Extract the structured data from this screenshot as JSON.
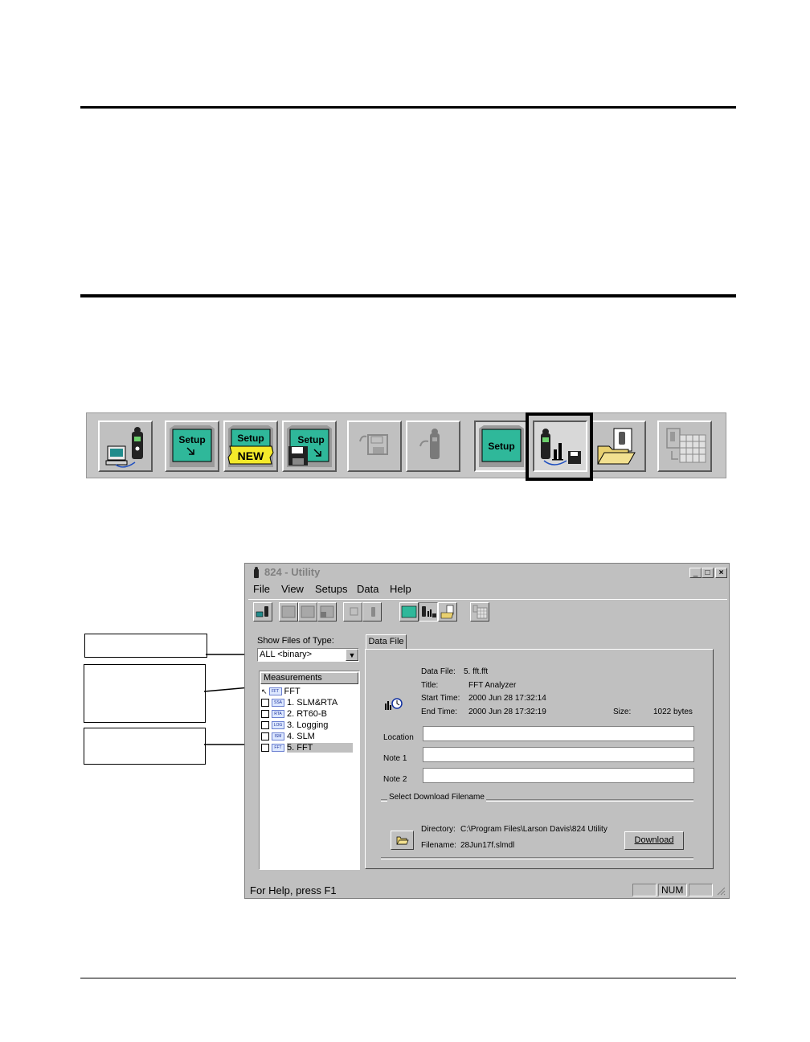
{
  "window": {
    "title": "824 - Utility",
    "controls": [
      "_",
      "□",
      "×"
    ]
  },
  "menu": [
    "File",
    "View",
    "Setups",
    "Data",
    "Help"
  ],
  "big_toolbar": {
    "highlighted_index": 7,
    "buttons": [
      {
        "icon": "computer-meter-icon"
      },
      {
        "icon": "setup-arrow-icon",
        "text": "Setup"
      },
      {
        "icon": "setup-new-icon",
        "text": "Setup",
        "badge": "NEW"
      },
      {
        "icon": "setup-save-icon",
        "text": "Setup"
      },
      {
        "icon": "save-disabled-icon"
      },
      {
        "icon": "meter-disabled-icon"
      },
      {
        "icon": "setup-screen-icon",
        "text": "Setup"
      },
      {
        "icon": "meter-chart-disk-icon"
      },
      {
        "icon": "folder-document-icon"
      },
      {
        "icon": "spreadsheet-disabled-icon"
      }
    ]
  },
  "file_type": {
    "label": "Show Files of Type:",
    "value": "ALL <binary>"
  },
  "measurements": {
    "header": "Measurements",
    "items": [
      {
        "tag": "FFT",
        "label": "FFT",
        "active": true
      },
      {
        "tag": "SSA",
        "label": "1. SLM&RTA"
      },
      {
        "tag": "RTA",
        "label": "2. RT60-B"
      },
      {
        "tag": "LOG",
        "label": "3. Logging"
      },
      {
        "tag": "ISM",
        "label": "4. SLM"
      },
      {
        "tag": "FFT",
        "label": "5. FFT",
        "selected": true
      }
    ]
  },
  "tab": {
    "label": "Data File"
  },
  "data_file": {
    "data_file_label": "Data File:",
    "data_file_value": "5. fft.fft",
    "title_label": "Title:",
    "title_value": "FFT Analyzer",
    "start_label": "Start Time:",
    "start_value": "2000 Jun 28 17:32:14",
    "end_label": "End Time:",
    "end_value": "2000 Jun 28 17:32:19",
    "size_label": "Size:",
    "size_value": "1022 bytes"
  },
  "fields": {
    "location_label": "Location",
    "note1_label": "Note 1",
    "note2_label": "Note 2"
  },
  "download": {
    "group_label": "Select Download Filename",
    "directory_label": "Directory:",
    "directory_value": "C:\\Program Files\\Larson Davis\\824 Utility",
    "filename_label": "Filename:",
    "filename_value": "28Jun17f.slmdl",
    "button_label": "Download"
  },
  "status": {
    "text": "For Help, press F1",
    "num": "NUM"
  },
  "colors": {
    "window_bg": "#c0c0c0",
    "setup_screen": "#2fb89a",
    "badge_yellow": "#f5ea2a"
  }
}
